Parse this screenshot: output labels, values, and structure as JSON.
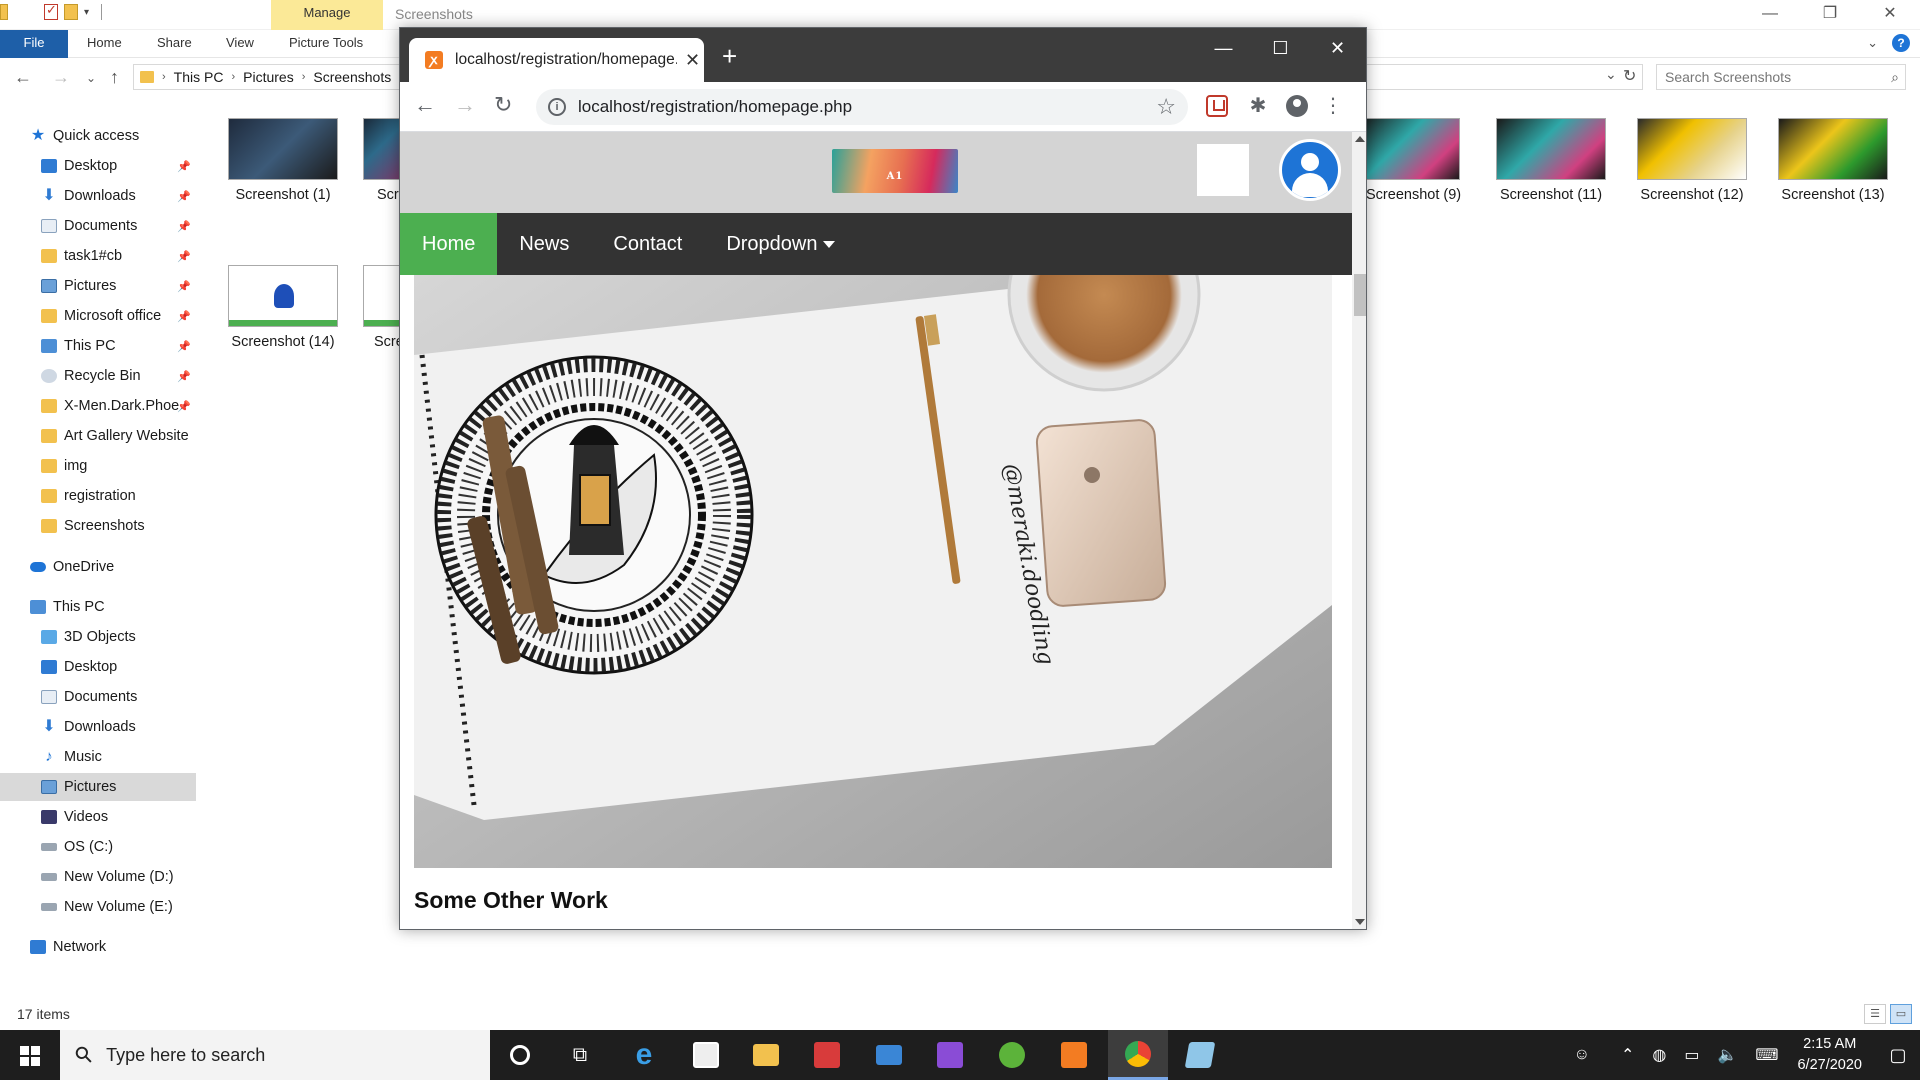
{
  "explorer": {
    "manage_label": "Manage",
    "window_title": "Screenshots",
    "ribbon": {
      "file": "File",
      "home": "Home",
      "share": "Share",
      "view": "View",
      "picture_tools": "Picture Tools"
    },
    "breadcrumb": [
      "This PC",
      "Pictures",
      "Screenshots"
    ],
    "search_placeholder": "Search Screenshots",
    "status": "17 items",
    "sidebar": {
      "quick_access": "Quick access",
      "quick_items": [
        "Desktop",
        "Downloads",
        "Documents",
        "task1#cb",
        "Pictures",
        "Microsoft office",
        "This PC",
        "Recycle Bin",
        "X-Men.Dark.Phoe",
        "Art Gallery Website",
        "img",
        "registration",
        "Screenshots"
      ],
      "onedrive": "OneDrive",
      "this_pc": "This PC",
      "pc_items": [
        "3D Objects",
        "Desktop",
        "Documents",
        "Downloads",
        "Music",
        "Pictures",
        "Videos",
        "OS (C:)",
        "New Volume (D:)",
        "New Volume (E:)"
      ],
      "network": "Network"
    },
    "thumbnails": [
      "Screenshot (1)",
      "Scr",
      "Screenshot (9)",
      "Screenshot (11)",
      "Screenshot (12)",
      "Screenshot (13)",
      "Screenshot (14)",
      "Scre"
    ]
  },
  "browser": {
    "tab_title": "localhost/registration/homepage.php",
    "url": "localhost/registration/homepage.php",
    "site": {
      "logo_text": "A1",
      "nav": [
        "Home",
        "News",
        "Contact",
        "Dropdown"
      ],
      "active_nav": "Home",
      "image_caption": "@meraki.doodling",
      "heading": "Some Other Work",
      "accent_color": "#4caf50",
      "header_bg": "#d4d4d4",
      "nav_bg": "#333333"
    }
  },
  "taskbar": {
    "search_placeholder": "Type here to search",
    "time": "2:15 AM",
    "date": "6/27/2020"
  }
}
